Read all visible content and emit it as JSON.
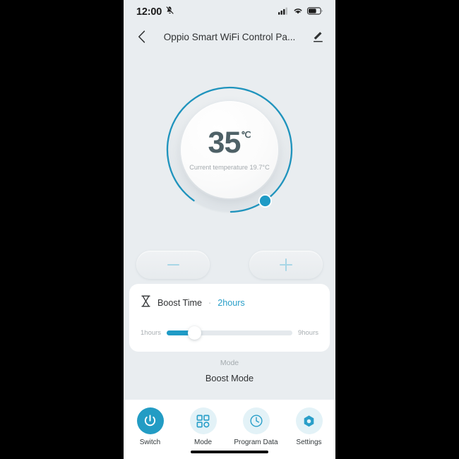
{
  "status_bar": {
    "time": "12:00",
    "mute_icon": "bell-muted-icon",
    "signal_icon": "cellular-signal-icon",
    "wifi_icon": "wifi-icon",
    "battery_icon": "battery-icon",
    "signal_bars_filled": 3,
    "signal_bars_total": 4,
    "battery_level_percent": 60
  },
  "header": {
    "back_icon": "chevron-left-icon",
    "title": "Oppio Smart WiFi Control Pa...",
    "edit_icon": "pencil-edit-icon"
  },
  "dial": {
    "target_temperature": "35",
    "unit": "℃",
    "current_temperature_text": "Current temperature 19.7°C",
    "arc_color": "#1e93bd",
    "handle_color": "#1f9bc6",
    "track_color": "#dfe4e8",
    "progress_fraction": 0.9
  },
  "stepper": {
    "minus_label": "minus-icon",
    "plus_label": "plus-icon",
    "icon_color": "#a8d6e6"
  },
  "boost_card": {
    "icon": "hourglass-icon",
    "label": "Boost Time",
    "separator": "·",
    "value": "2hours",
    "value_color": "#2a9fc9",
    "slider": {
      "min_label": "1hours",
      "max_label": "9hours",
      "current": 2,
      "min": 1,
      "max": 9,
      "fill_color": "#1f9bc6"
    }
  },
  "mode_section": {
    "caption": "Mode",
    "value": "Boost Mode"
  },
  "bottom_nav": {
    "items": [
      {
        "label": "Switch",
        "icon": "power-icon",
        "active": true
      },
      {
        "label": "Mode",
        "icon": "grid-squares-icon",
        "active": false
      },
      {
        "label": "Program Data",
        "icon": "clock-icon",
        "active": false
      },
      {
        "label": "Settings",
        "icon": "hexagon-gear-icon",
        "active": false
      }
    ],
    "active_bg": "#239cc4",
    "inactive_bg": "#e3f2f7",
    "icon_color": "#2a9fc9"
  }
}
